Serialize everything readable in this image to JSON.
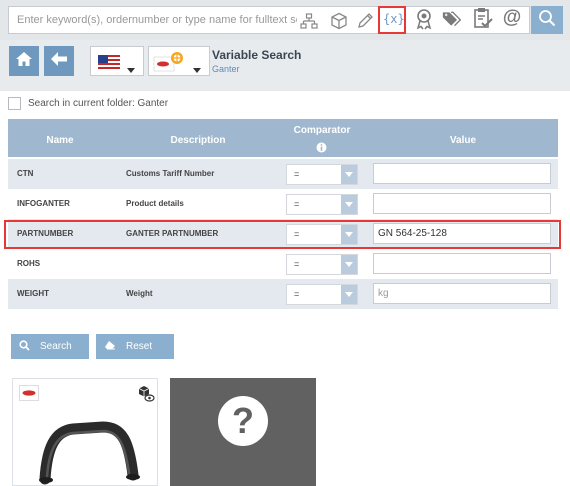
{
  "search": {
    "placeholder": "Enter keyword(s), ordernumber or type name for fulltext searc"
  },
  "toolbar": {
    "variable_search_glyph": "{x}",
    "at_glyph": "@"
  },
  "header": {
    "title": "Variable Search",
    "subtitle": "Ganter"
  },
  "options": {
    "search_in_folder_label": "Search in current folder: Ganter"
  },
  "table": {
    "headers": {
      "name": "Name",
      "description": "Description",
      "comparator": "Comparator",
      "value": "Value"
    },
    "rows": [
      {
        "name": "CTN",
        "description": "Customs Tariff Number",
        "comparator": "=",
        "value": "",
        "placeholder": ""
      },
      {
        "name": "INFOGANTER",
        "description": "Product details",
        "comparator": "=",
        "value": "",
        "placeholder": ""
      },
      {
        "name": "PARTNUMBER",
        "description": "GANTER PARTNUMBER",
        "comparator": "=",
        "value": "GN 564-25-128",
        "placeholder": ""
      },
      {
        "name": "ROHS",
        "description": "",
        "comparator": "=",
        "value": "",
        "placeholder": ""
      },
      {
        "name": "WEIGHT",
        "description": "Weight",
        "comparator": "=",
        "value": "",
        "placeholder": "kg"
      }
    ]
  },
  "actions": {
    "search_label": "Search",
    "reset_label": "Reset"
  },
  "results": {
    "tile2_glyph": "?"
  },
  "colors": {
    "accent": "#6f98bf",
    "highlight": "#e53935",
    "table_header": "#9fb8cf"
  }
}
